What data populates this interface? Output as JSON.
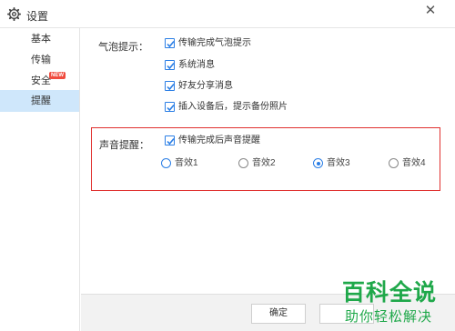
{
  "window": {
    "title": "设置",
    "close_label": "✕"
  },
  "sidebar": {
    "items": [
      {
        "label": "基本",
        "active": false
      },
      {
        "label": "传输",
        "active": false
      },
      {
        "label": "安全",
        "badge": "NEW",
        "active": false
      },
      {
        "label": "提醒",
        "active": true
      }
    ]
  },
  "bubble": {
    "label": "气泡提示：",
    "options": [
      {
        "label": "传输完成气泡提示",
        "checked": true
      },
      {
        "label": "系统消息",
        "checked": true
      },
      {
        "label": "好友分享消息",
        "checked": true
      },
      {
        "label": "插入设备后，提示备份照片",
        "checked": true
      }
    ]
  },
  "sound": {
    "label": "声音提醒：",
    "checkbox": {
      "label": "传输完成后声音提醒",
      "checked": true
    },
    "radios": [
      {
        "label": "音效1",
        "checked": false,
        "focus": true
      },
      {
        "label": "音效2",
        "checked": false
      },
      {
        "label": "音效3",
        "checked": true
      },
      {
        "label": "音效4",
        "checked": false
      }
    ]
  },
  "footer": {
    "ok_label": "确定",
    "cancel_label": ""
  },
  "watermark": {
    "title": "百科全说",
    "subtitle": "助你轻松解决"
  },
  "colors": {
    "accent": "#2a7ee5",
    "highlight_border": "#e0312f",
    "active_item": "#cfe7fb",
    "watermark": "#1fa84a"
  }
}
